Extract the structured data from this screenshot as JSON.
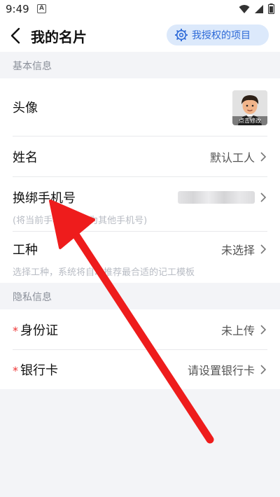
{
  "status_bar": {
    "time": "9:49",
    "notif_glyph": "A"
  },
  "header": {
    "title": "我的名片",
    "auth_button_label": "我授权的项目"
  },
  "sections": {
    "basic": "基本信息",
    "privacy": "隐私信息"
  },
  "rows": {
    "avatar": {
      "label": "头像",
      "caption": "点击修改"
    },
    "name": {
      "label": "姓名",
      "value": "默认工人"
    },
    "phone": {
      "label": "换绑手机号",
      "hint": "(将当前手机号更换为其他手机号)"
    },
    "trade": {
      "label": "工种",
      "value": "未选择",
      "hint": "选择工种，系统将自动推荐最合适的记工模板"
    },
    "id_card": {
      "required_mark": "*",
      "label": "身份证",
      "value": "未上传"
    },
    "bank_card": {
      "required_mark": "*",
      "label": "银行卡",
      "value": "请设置银行卡"
    }
  },
  "colors": {
    "accent": "#2f6bd8",
    "accent_bg": "#dce9fb",
    "required": "#ee3333",
    "annotation_arrow": "#ee1c1c",
    "page_bg": "#f3f4f7"
  },
  "icons": {
    "back": "back-arrow-icon",
    "settings": "gear-icon",
    "chevron": "chevron-right-icon",
    "wifi": "wifi-icon",
    "signal": "signal-icon",
    "battery": "battery-icon"
  }
}
